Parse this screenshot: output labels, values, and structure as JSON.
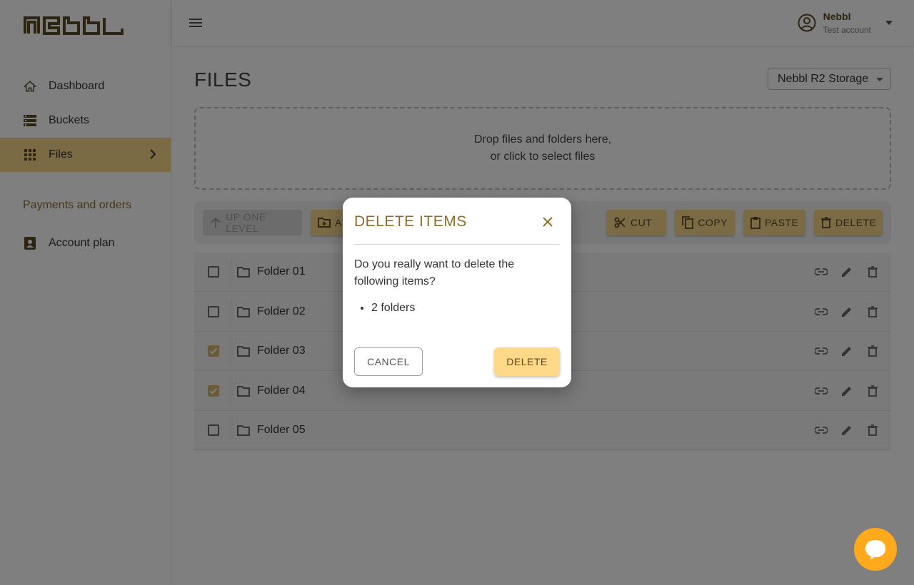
{
  "app": {
    "logo_text": "Nebbl"
  },
  "sidebar": {
    "items": [
      {
        "label": "Dashboard",
        "icon": "home-icon"
      },
      {
        "label": "Buckets",
        "icon": "storage-icon"
      },
      {
        "label": "Files",
        "icon": "grid-icon",
        "active": true
      }
    ],
    "section_label": "Payments and orders",
    "section_items": [
      {
        "label": "Account plan",
        "icon": "account-box-icon"
      }
    ]
  },
  "header": {
    "user_name": "Nebbl",
    "user_sub": "Test account"
  },
  "main": {
    "title": "FILES",
    "storage_selected": "Nebbl R2 Storage",
    "dropzone_line1": "Drop files and folders here,",
    "dropzone_line2": "or click to select files",
    "toolbar": {
      "up_label": "UP ONE LEVEL",
      "add_label": "A",
      "cut_label": "CUT",
      "copy_label": "COPY",
      "paste_label": "PASTE",
      "delete_label": "DELETE"
    },
    "rows": [
      {
        "name": "Folder 01",
        "checked": false
      },
      {
        "name": "Folder 02",
        "checked": false
      },
      {
        "name": "Folder 03",
        "checked": true
      },
      {
        "name": "Folder 04",
        "checked": true
      },
      {
        "name": "Folder 05",
        "checked": false
      }
    ]
  },
  "dialog": {
    "title": "DELETE ITEMS",
    "message": "Do you really want to delete the following items?",
    "items": [
      "2 folders"
    ],
    "cancel_label": "CANCEL",
    "confirm_label": "DELETE"
  },
  "colors": {
    "accent": "#f6d68a",
    "accent_dark": "#8c6e2a",
    "chat": "#ffa91c"
  }
}
